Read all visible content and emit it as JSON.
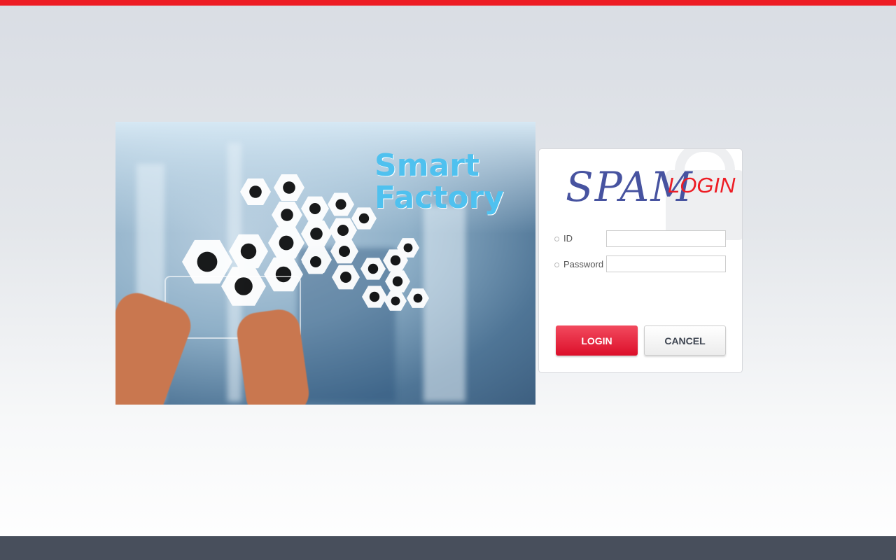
{
  "hero": {
    "title_line1": "Smart",
    "title_line2": "Factory"
  },
  "login": {
    "logo_text": "SPAM",
    "logo_suffix": "LOGIN",
    "id_label": "ID",
    "id_value": "",
    "password_label": "Password",
    "password_value": "",
    "login_button": "LOGIN",
    "cancel_button": "CANCEL"
  },
  "colors": {
    "accent": "#ed1c24",
    "brand": "#4753a0",
    "footer": "#484f5c",
    "title": "#4fc1ef"
  }
}
